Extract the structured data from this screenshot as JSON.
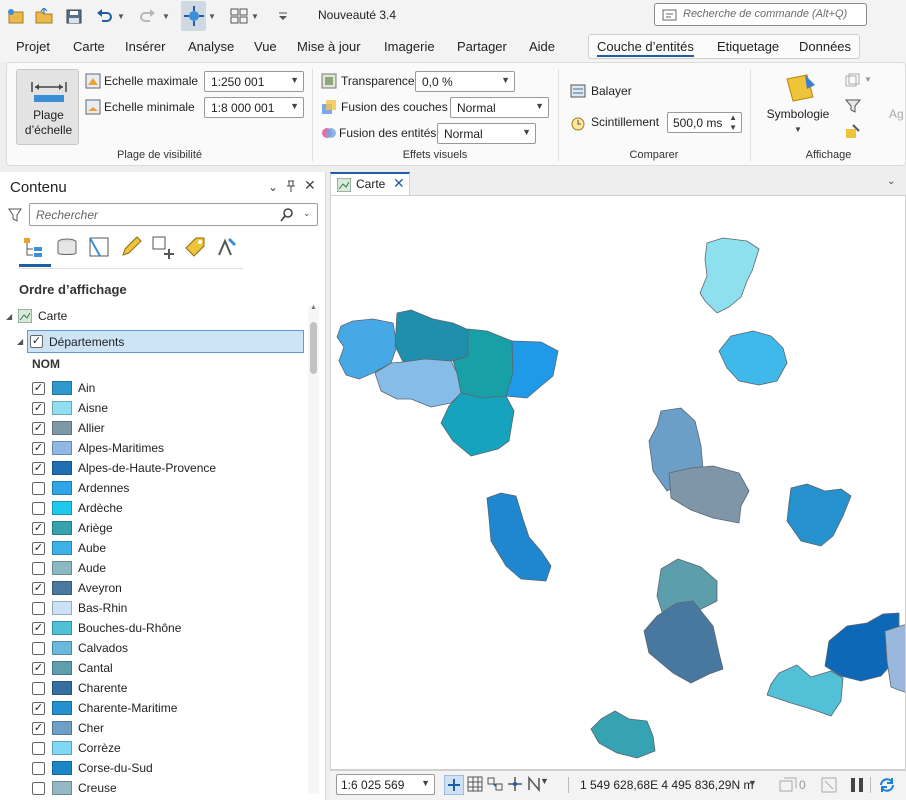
{
  "app": {
    "title": "Nouveauté 3.4"
  },
  "search": {
    "placeholder": "Recherche de commande (Alt+Q)"
  },
  "menu": {
    "tabs": [
      "Projet",
      "Carte",
      "Insérer",
      "Analyse",
      "Vue",
      "Mise à jour",
      "Imagerie",
      "Partager",
      "Aide"
    ],
    "context_tabs": [
      "Couche d’entités",
      "Etiquetage",
      "Données"
    ]
  },
  "ribbon": {
    "scale_button": "Plage d’échelle",
    "max_scale_label": "Echelle maximale",
    "max_scale_value": "1:250 001",
    "min_scale_label": "Echelle minimale",
    "min_scale_value": "1:8 000 001",
    "group_visibility": "Plage de visibilité",
    "transparency_label": "Transparence",
    "transparency_value": "0,0 %",
    "layer_blend_label": "Fusion des couches",
    "layer_blend_value": "Normal",
    "feature_blend_label": "Fusion des entités",
    "feature_blend_value": "Normal",
    "group_effects": "Effets visuels",
    "swipe_label": "Balayer",
    "flicker_label": "Scintillement",
    "flicker_value": "500,0 ms",
    "group_compare": "Comparer",
    "symbology_label": "Symbologie",
    "group_display": "Affichage",
    "cut_label": "Ag"
  },
  "contents": {
    "title": "Contenu",
    "search_placeholder": "Rechercher",
    "draw_order_label": "Ordre d’affichage",
    "map_item": "Carte",
    "layer_item": "Départements",
    "field_header": "NOM",
    "items": [
      {
        "name": "Ain",
        "checked": true,
        "color": "#2f98cc"
      },
      {
        "name": "Aisne",
        "checked": true,
        "color": "#8fdff0"
      },
      {
        "name": "Allier",
        "checked": true,
        "color": "#7e98a8"
      },
      {
        "name": "Alpes-Maritimes",
        "checked": true,
        "color": "#8fb8e4"
      },
      {
        "name": "Alpes-de-Haute-Provence",
        "checked": true,
        "color": "#1f6fb4"
      },
      {
        "name": "Ardennes",
        "checked": false,
        "color": "#2ea6e8"
      },
      {
        "name": "Ardèche",
        "checked": false,
        "color": "#1fc8ec"
      },
      {
        "name": "Ariège",
        "checked": true,
        "color": "#37a3b0"
      },
      {
        "name": "Aube",
        "checked": true,
        "color": "#3db2ea"
      },
      {
        "name": "Aude",
        "checked": false,
        "color": "#8bbac4"
      },
      {
        "name": "Aveyron",
        "checked": true,
        "color": "#4a79a0"
      },
      {
        "name": "Bas-Rhin",
        "checked": false,
        "color": "#cbe2f6"
      },
      {
        "name": "Bouches-du-Rhône",
        "checked": true,
        "color": "#4fc0d6"
      },
      {
        "name": "Calvados",
        "checked": false,
        "color": "#6ab8dc"
      },
      {
        "name": "Cantal",
        "checked": true,
        "color": "#5f9fab"
      },
      {
        "name": "Charente",
        "checked": false,
        "color": "#356fa0"
      },
      {
        "name": "Charente-Maritime",
        "checked": true,
        "color": "#2590d0"
      },
      {
        "name": "Cher",
        "checked": true,
        "color": "#6d9fc7"
      },
      {
        "name": "Corrèze",
        "checked": false,
        "color": "#7fd8f4"
      },
      {
        "name": "Corse-du-Sud",
        "checked": false,
        "color": "#1b86c8"
      },
      {
        "name": "Creuse",
        "checked": false,
        "color": "#94b8c6"
      }
    ]
  },
  "map": {
    "tab_label": "Carte"
  },
  "status": {
    "scale": "1:6 025 569",
    "coordinates": "1 549 628,68E 4 495 836,29N m",
    "selected_count": "0"
  }
}
